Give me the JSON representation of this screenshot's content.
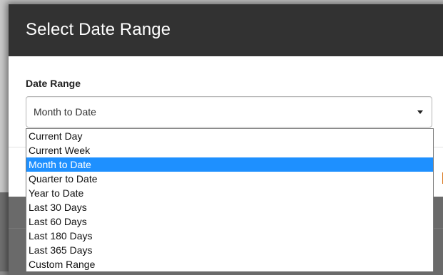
{
  "modal": {
    "title": "Select Date Range"
  },
  "field": {
    "label": "Date Range",
    "selected_value": "Month to Date"
  },
  "dropdown": {
    "options": [
      "Current Day",
      "Current Week",
      "Month to Date",
      "Quarter to Date",
      "Year to Date",
      "Last 30 Days",
      "Last 60 Days",
      "Last 180 Days",
      "Last 365 Days",
      "Custom Range"
    ],
    "highlighted": "Month to Date",
    "highlight_color": "#1e90ff"
  },
  "icons": {
    "select_caret": "caret-down-icon"
  }
}
